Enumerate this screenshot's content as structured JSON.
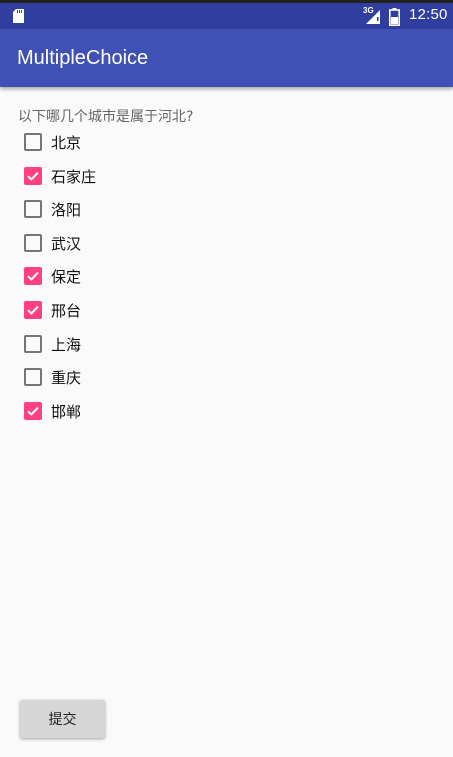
{
  "status_bar": {
    "network_label": "3G",
    "time": "12:50"
  },
  "app_bar": {
    "title": "MultipleChoice"
  },
  "question": "以下哪几个城市是属于河北?",
  "options": [
    {
      "label": "北京",
      "checked": false
    },
    {
      "label": "石家庄",
      "checked": true
    },
    {
      "label": "洛阳",
      "checked": false
    },
    {
      "label": "武汉",
      "checked": false
    },
    {
      "label": "保定",
      "checked": true
    },
    {
      "label": "邢台",
      "checked": true
    },
    {
      "label": "上海",
      "checked": false
    },
    {
      "label": "重庆",
      "checked": false
    },
    {
      "label": "邯郸",
      "checked": true
    }
  ],
  "submit_label": "提交",
  "colors": {
    "primary": "#3f51b5",
    "primary_dark": "#303f9f",
    "accent": "#ff4081"
  }
}
